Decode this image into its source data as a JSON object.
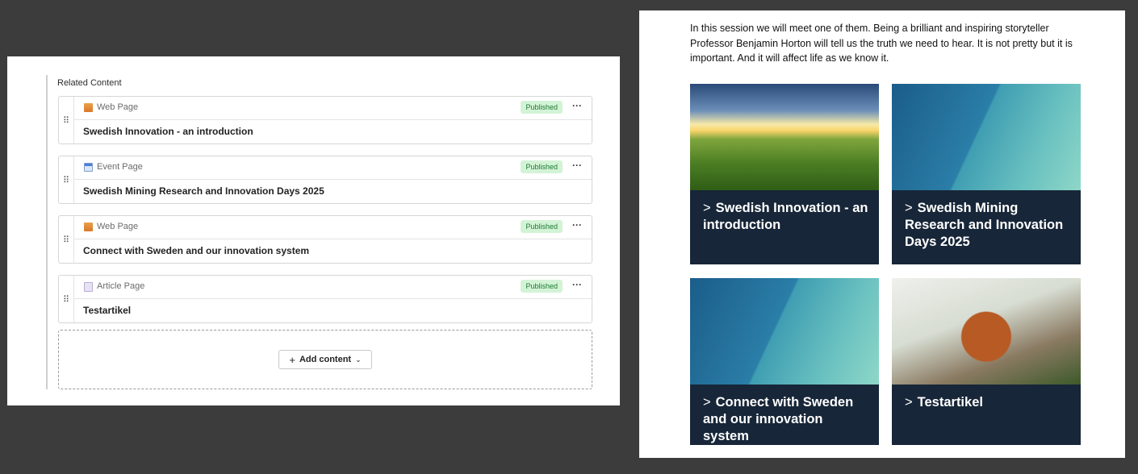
{
  "editor": {
    "section_title": "Related Content",
    "items": [
      {
        "type": "Web Page",
        "status": "Published",
        "title": "Swedish Innovation - an introduction",
        "icon": "web-page-icon"
      },
      {
        "type": "Event Page",
        "status": "Published",
        "title": "Swedish Mining Research and Innovation Days 2025",
        "icon": "event-page-icon"
      },
      {
        "type": "Web Page",
        "status": "Published",
        "title": "Connect with Sweden and our innovation system",
        "icon": "web-page-icon"
      },
      {
        "type": "Article Page",
        "status": "Published",
        "title": "Testartikel",
        "icon": "article-page-icon"
      }
    ],
    "more_label": "···",
    "drag_label": "⠿",
    "add_button": {
      "plus": "+",
      "label": "Add content",
      "chevron": "⌄"
    }
  },
  "preview": {
    "intro": "In this session we will meet one of them. Being a brilliant and inspiring storyteller Professor Benjamin Horton will tell us the truth we need to hear. It is not pretty but it is important. And it will affect life as we know it.",
    "arrow": ">",
    "cards": [
      {
        "title": "Swedish Innovation - an introduction",
        "image": "sunlit-road-landscape"
      },
      {
        "title": "Swedish Mining Research and Innovation Days 2025",
        "image": "teal-gradient"
      },
      {
        "title": "Connect with Sweden and our innovation system",
        "image": "teal-gradient"
      },
      {
        "title": "Testartikel",
        "image": "red-panda-on-branch"
      }
    ]
  },
  "colors": {
    "background": "#3c3c3c",
    "card_bg": "#172638",
    "badge_bg": "#d3f3d6",
    "badge_text": "#1f7a33"
  }
}
